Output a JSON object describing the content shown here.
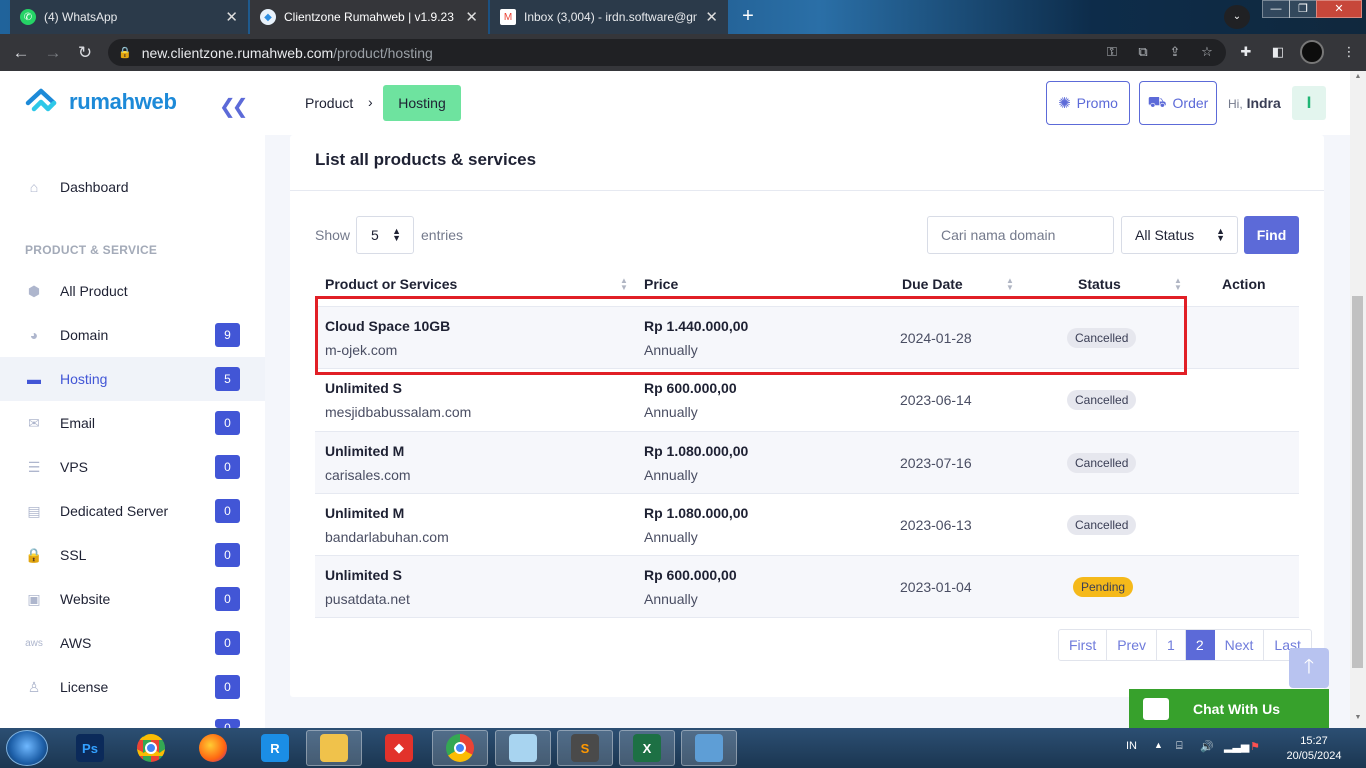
{
  "browser": {
    "tabs": [
      {
        "title": "(4) WhatsApp",
        "icon": "whatsapp-icon",
        "color": "#25d366"
      },
      {
        "title": "Clientzone Rumahweb | v1.9.23",
        "icon": "rumahweb-icon",
        "color": "#2d8ee0"
      },
      {
        "title": "Inbox (3,004) - irdn.software@gm",
        "icon": "gmail-icon",
        "color": "#ea4335"
      }
    ],
    "url_host": "new.clientzone.rumahweb.com",
    "url_path": "/product/hosting"
  },
  "sidebar": {
    "logo_text": "rumahweb",
    "section_title": "PRODUCT & SERVICE",
    "dashboard": "Dashboard",
    "items": [
      {
        "label": "All Product",
        "icon": "cube-icon",
        "badge": ""
      },
      {
        "label": "Domain",
        "icon": "globe-icon",
        "badge": "9"
      },
      {
        "label": "Hosting",
        "icon": "hosting-icon",
        "badge": "5"
      },
      {
        "label": "Email",
        "icon": "email-icon",
        "badge": "0"
      },
      {
        "label": "VPS",
        "icon": "server-icon",
        "badge": "0"
      },
      {
        "label": "Dedicated Server",
        "icon": "dedicated-server-icon",
        "badge": "0"
      },
      {
        "label": "SSL",
        "icon": "lock-icon",
        "badge": "0"
      },
      {
        "label": "Website",
        "icon": "website-icon",
        "badge": "0"
      },
      {
        "label": "AWS",
        "icon": "aws-icon",
        "badge": "0"
      },
      {
        "label": "License",
        "icon": "license-icon",
        "badge": "0"
      }
    ],
    "partial_badge": "0"
  },
  "header": {
    "breadcrumb_1": "Product",
    "breadcrumb_2": "Hosting",
    "promo": "Promo",
    "order": "Order",
    "hi": "Hi,",
    "user": "Indra",
    "avatar": "I"
  },
  "list": {
    "title": "List all products & services",
    "show": "Show",
    "entries_value": "5",
    "entries": "entries",
    "search_placeholder": "Cari nama domain",
    "status_value": "All Status",
    "find": "Find",
    "columns": [
      "Product or Services",
      "Price",
      "Due Date",
      "Status",
      "Action"
    ],
    "rows": [
      {
        "name": "Cloud Space 10GB",
        "domain": "m-ojek.com",
        "price": "Rp 1.440.000,00",
        "cycle": "Annually",
        "due": "2024-01-28",
        "status": "Cancelled"
      },
      {
        "name": "Unlimited S",
        "domain": "mesjidbabussalam.com",
        "price": "Rp 600.000,00",
        "cycle": "Annually",
        "due": "2023-06-14",
        "status": "Cancelled"
      },
      {
        "name": "Unlimited M",
        "domain": "carisales.com",
        "price": "Rp 1.080.000,00",
        "cycle": "Annually",
        "due": "2023-07-16",
        "status": "Cancelled"
      },
      {
        "name": "Unlimited M",
        "domain": "bandarlabuhan.com",
        "price": "Rp 1.080.000,00",
        "cycle": "Annually",
        "due": "2023-06-13",
        "status": "Cancelled"
      },
      {
        "name": "Unlimited S",
        "domain": "pusatdata.net",
        "price": "Rp 600.000,00",
        "cycle": "Annually",
        "due": "2023-01-04",
        "status": "Pending"
      }
    ],
    "pagination": [
      "First",
      "Prev",
      "1",
      "2",
      "Next",
      "Last"
    ],
    "current_page": "2"
  },
  "chat": "Chat With Us",
  "taskbar": {
    "lang": "IN",
    "time": "15:27",
    "date": "20/05/2024"
  },
  "colors": {
    "accent": "#5c6ad8",
    "highlight": "#e11f26",
    "chat": "#37a12c",
    "pending": "#f5b91a"
  }
}
